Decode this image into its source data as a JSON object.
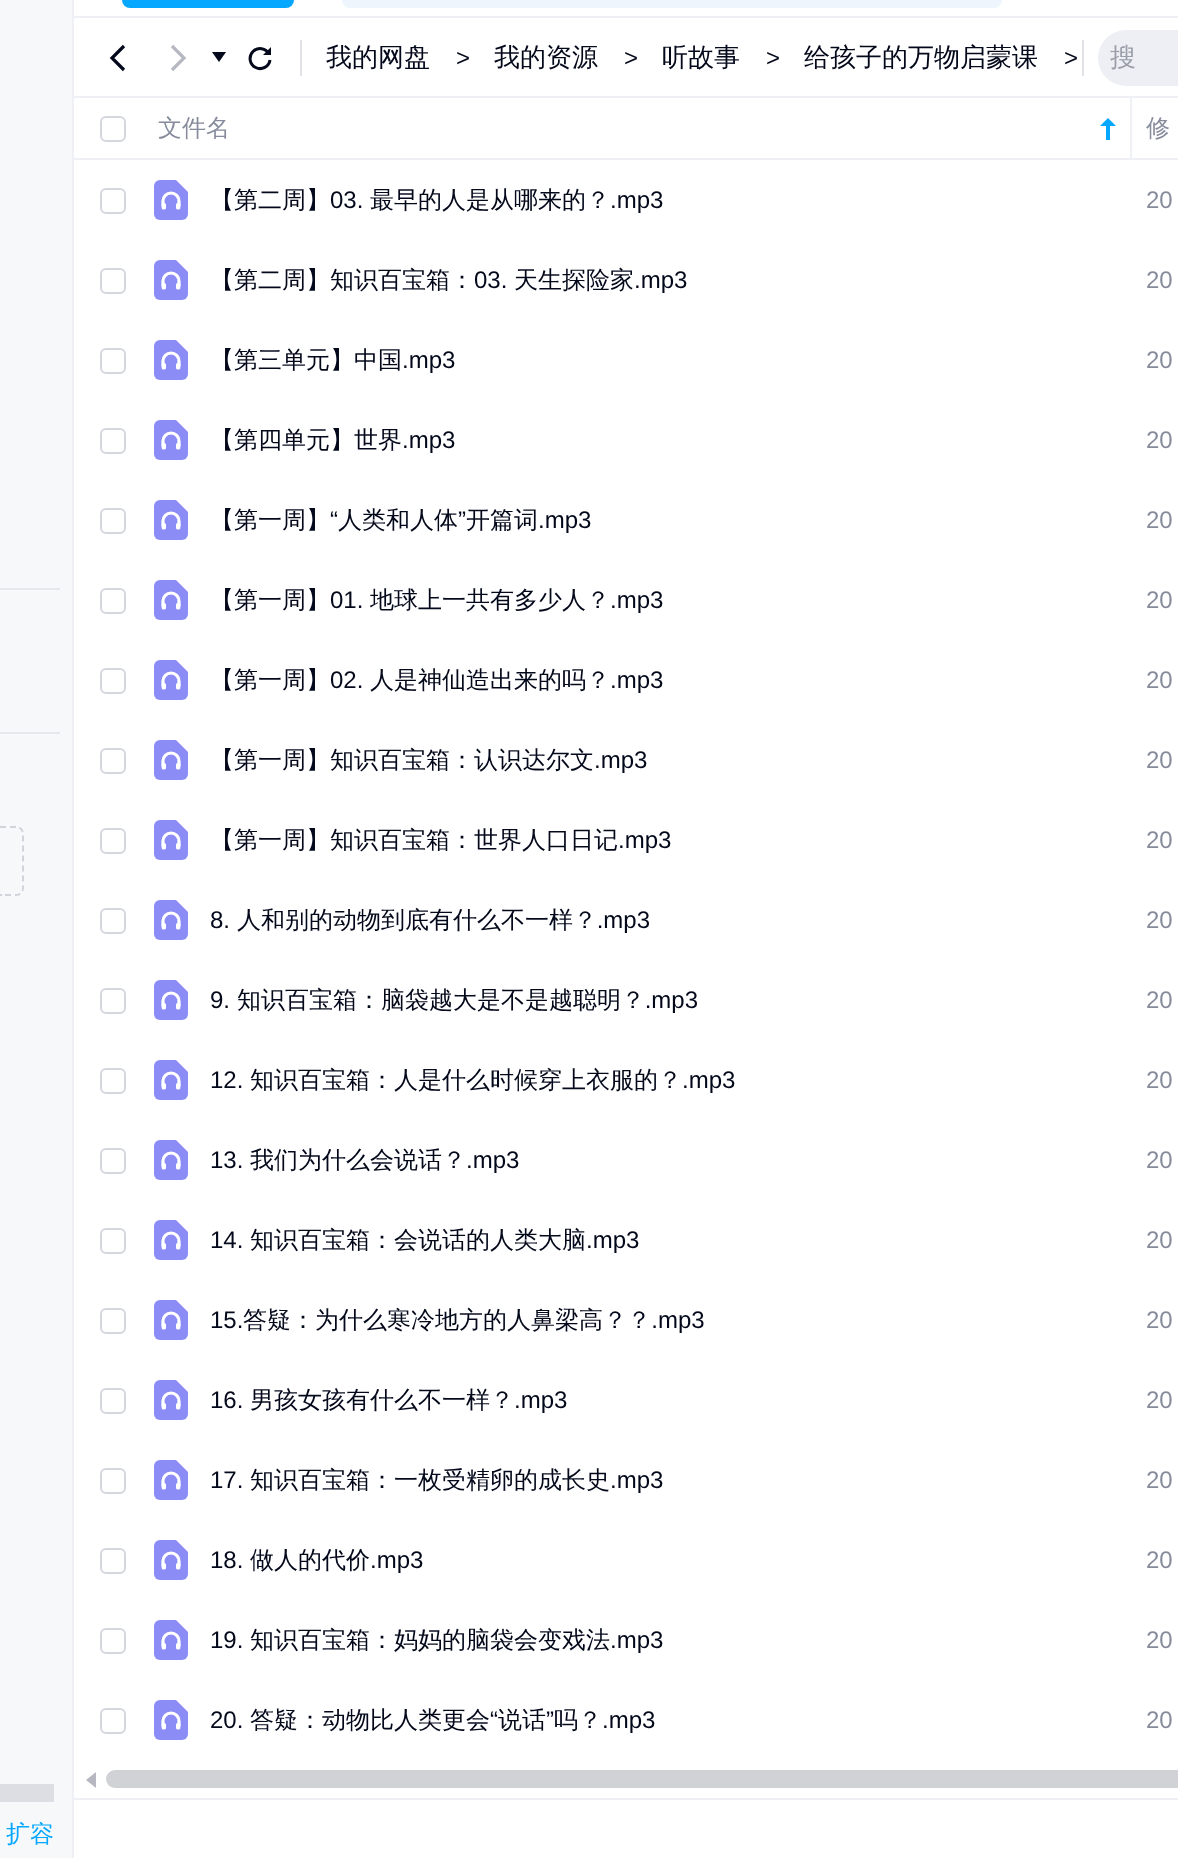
{
  "sidebar": {
    "expand_link": "扩容"
  },
  "breadcrumb": [
    {
      "label": "我的网盘",
      "separator": ">"
    },
    {
      "label": "我的资源",
      "separator": ">"
    },
    {
      "label": "听故事",
      "separator": ">"
    },
    {
      "label": "给孩子的万物启蒙课",
      "separator": ">"
    }
  ],
  "search": {
    "placeholder": "搜"
  },
  "table": {
    "select_all_checked": false,
    "columns": [
      {
        "label": "文件名",
        "sorted": true
      },
      {
        "label": "修"
      }
    ],
    "rows": [
      {
        "name": "【第二周】03. 最早的人是从哪来的？.mp3",
        "date": "20",
        "checked": false
      },
      {
        "name": "【第二周】知识百宝箱：03. 天生探险家.mp3",
        "date": "20",
        "checked": false
      },
      {
        "name": "【第三单元】中国.mp3",
        "date": "20",
        "checked": false
      },
      {
        "name": "【第四单元】世界.mp3",
        "date": "20",
        "checked": false
      },
      {
        "name": "【第一周】“人类和人体”开篇词.mp3",
        "date": "20",
        "checked": false
      },
      {
        "name": "【第一周】01. 地球上一共有多少人？.mp3",
        "date": "20",
        "checked": false
      },
      {
        "name": "【第一周】02. 人是神仙造出来的吗？.mp3",
        "date": "20",
        "checked": false
      },
      {
        "name": "【第一周】知识百宝箱：认识达尔文.mp3",
        "date": "20",
        "checked": false
      },
      {
        "name": "【第一周】知识百宝箱：世界人口日记.mp3",
        "date": "20",
        "checked": false
      },
      {
        "name": "8. 人和别的动物到底有什么不一样？.mp3",
        "date": "20",
        "checked": false
      },
      {
        "name": "9. 知识百宝箱：脑袋越大是不是越聪明？.mp3",
        "date": "20",
        "checked": false
      },
      {
        "name": "12. 知识百宝箱：人是什么时候穿上衣服的？.mp3",
        "date": "20",
        "checked": false
      },
      {
        "name": "13. 我们为什么会说话？.mp3",
        "date": "20",
        "checked": false
      },
      {
        "name": "14. 知识百宝箱：会说话的人类大脑.mp3",
        "date": "20",
        "checked": false
      },
      {
        "name": "15.答疑：为什么寒冷地方的人鼻梁高？？.mp3",
        "date": "20",
        "checked": false
      },
      {
        "name": "16. 男孩女孩有什么不一样？.mp3",
        "date": "20",
        "checked": false
      },
      {
        "name": "17. 知识百宝箱：一枚受精卵的成长史.mp3",
        "date": "20",
        "checked": false
      },
      {
        "name": "18. 做人的代价.mp3",
        "date": "20",
        "checked": false
      },
      {
        "name": "19. 知识百宝箱：妈妈的脑袋会变戏法.mp3",
        "date": "20",
        "checked": false
      },
      {
        "name": "20. 答疑：动物比人类更会“说话”吗？.mp3",
        "date": "20",
        "checked": false
      }
    ]
  }
}
